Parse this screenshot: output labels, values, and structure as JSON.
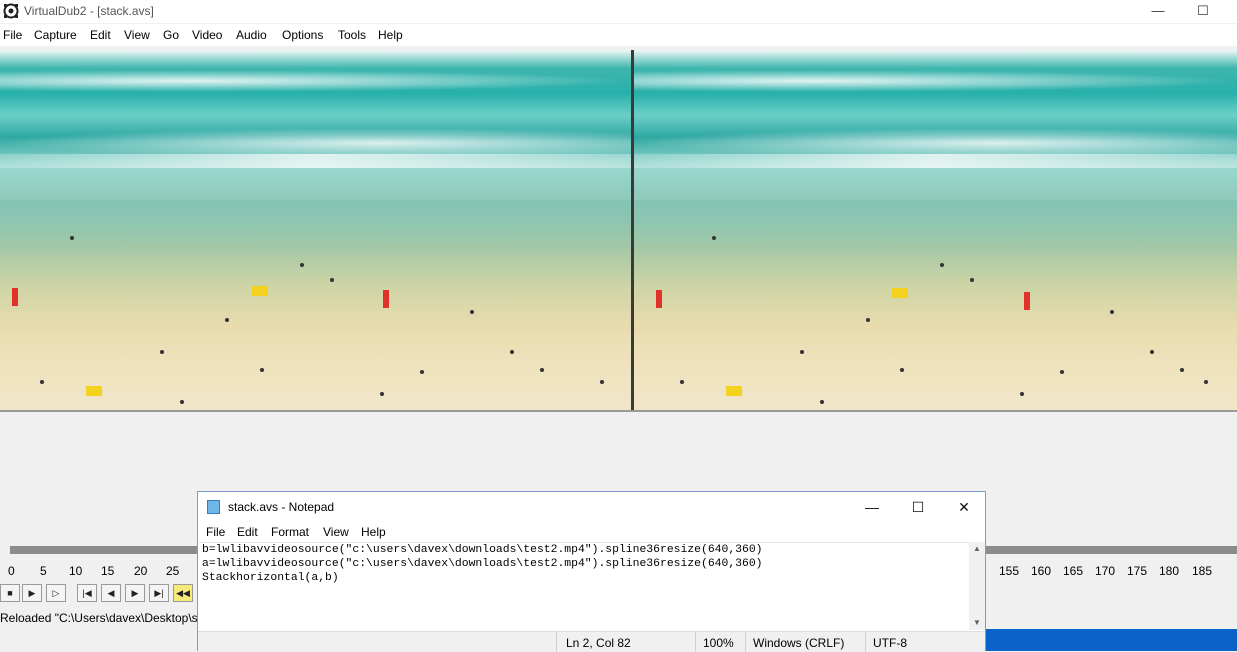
{
  "vd": {
    "title": "VirtualDub2  - [stack.avs]",
    "menu": [
      "File",
      "Capture",
      "Edit",
      "View",
      "Go",
      "Video",
      "Audio",
      "Options",
      "Tools",
      "Help"
    ],
    "ticks_left": [
      "0",
      "5",
      "10",
      "15",
      "20",
      "25"
    ],
    "ticks_right": [
      "155",
      "160",
      "165",
      "170",
      "175",
      "180",
      "185"
    ],
    "status": "Reloaded \"C:\\Users\\davex\\Desktop\\st"
  },
  "notepad": {
    "title": "stack.avs - Notepad",
    "menu": [
      "File",
      "Edit",
      "Format",
      "View",
      "Help"
    ],
    "lines": [
      "b=lwlibavvideosource(\"c:\\users\\davex\\downloads\\test2.mp4\").spline36resize(640,360)",
      "a=lwlibavvideosource(\"c:\\users\\davex\\downloads\\test2.mp4\").spline36resize(640,360)",
      "Stackhorizontal(a,b)"
    ],
    "status": {
      "position": "Ln 2, Col 82",
      "zoom": "100%",
      "line_ending": "Windows (CRLF)",
      "encoding": "UTF-8"
    }
  },
  "icons": {
    "minimize": "minimize-icon",
    "maximize": "maximize-icon",
    "close": "close-icon"
  }
}
